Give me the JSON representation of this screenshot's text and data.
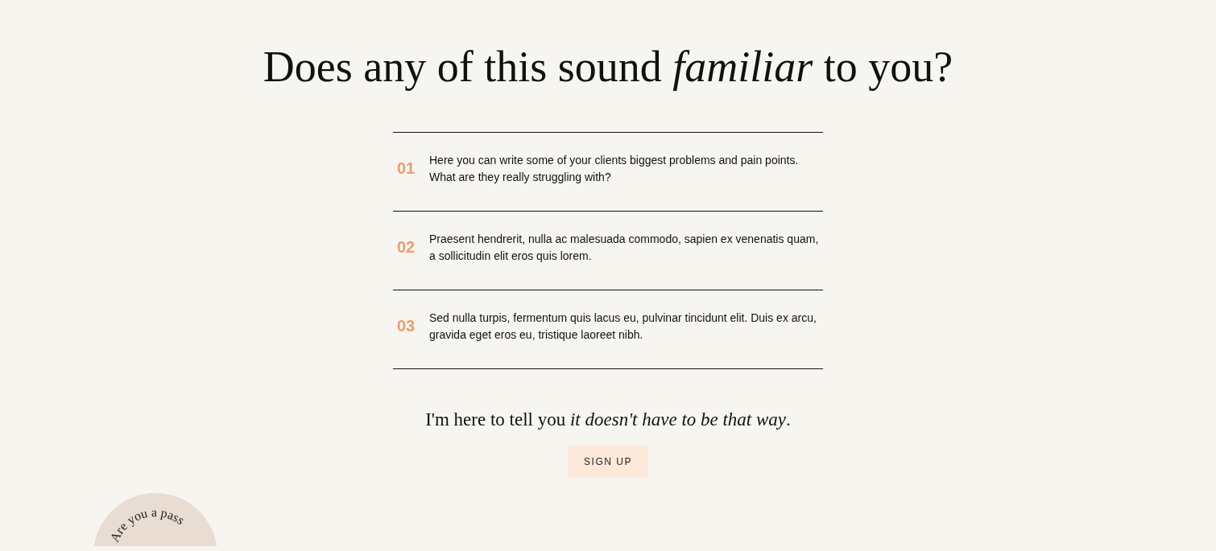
{
  "heading": "Does any of this sound *familiar* to you?",
  "problems": [
    {
      "number": "01",
      "text": "Here you can write some of your clients biggest problems and pain points. What are they really struggling with?"
    },
    {
      "number": "02",
      "text": "Praesent hendrerit, nulla ac malesuada commodo, sapien ex venenatis quam, a sollicitudin elit eros quis lorem."
    },
    {
      "number": "03",
      "text": "Sed nulla turpis, fermentum quis lacus eu, pulvinar tincidunt elit. Duis ex arcu, gravida eget eros eu, tristique laoreet nibh."
    }
  ],
  "tagline": "I'm here to tell you *it doesn't have to be that way*.",
  "button": "SIGN UP",
  "badge": {
    "text": "Are you a pass"
  }
}
